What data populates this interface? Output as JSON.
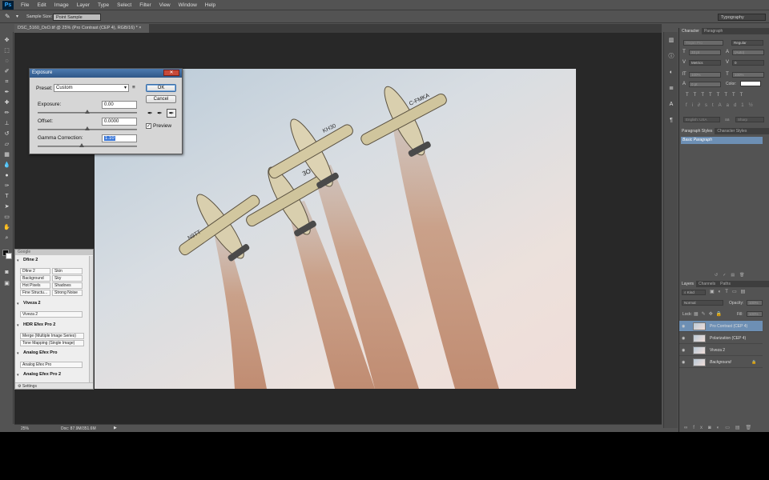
{
  "app": {
    "logo": "Ps"
  },
  "menubar": {
    "items": [
      "File",
      "Edit",
      "Image",
      "Layer",
      "Type",
      "Select",
      "Filter",
      "View",
      "Window",
      "Help"
    ]
  },
  "options": {
    "sample_size_label": "Sample Size:",
    "sample_size_value": "Point Sample",
    "workspace": "Typography"
  },
  "document": {
    "tab_title": "DSC_5160_DxO.tif @ 25% (Pro Contrast (CEP 4), RGB/16) *"
  },
  "status": {
    "zoom": "25%",
    "doc_info": "Doc: 87.9M/351.6M"
  },
  "exposure_dialog": {
    "title": "Exposure",
    "preset_label": "Preset:",
    "preset_value": "Custom",
    "exposure_label": "Exposure:",
    "exposure_value": "0.00",
    "offset_label": "Offset:",
    "offset_value": "0.0000",
    "gamma_label": "Gamma Correction:",
    "gamma_value": "1.10",
    "ok": "OK",
    "cancel": "Cancel",
    "preview": "Preview",
    "preview_checked": true
  },
  "google_panel": {
    "title": "Google",
    "dfine": {
      "title": "Dfine 2",
      "buttons": [
        "Dfine 2",
        "Skin",
        "Background",
        "Sky",
        "Hot Pixels",
        "Shadows",
        "Fine Structu...",
        "Strong Noise"
      ]
    },
    "viveza": {
      "title": "Viveza 2",
      "buttons": [
        "Viveza 2"
      ]
    },
    "hdr": {
      "title": "HDR Efex Pro 2",
      "buttons": [
        "Merge (Multiple Image Series)",
        "Tone Mapping (Single Image)"
      ]
    },
    "analog1": {
      "title": "Analog Efex Pro",
      "buttons": [
        "Analog Efex Pro"
      ]
    },
    "analog2": {
      "title": "Analog Efex Pro 2"
    },
    "settings": "Settings"
  },
  "character_panel": {
    "tabs": [
      "Character",
      "Paragraph"
    ],
    "font_family": "Trajan Pro",
    "font_style": "Regular",
    "size": "33 pt",
    "leading": "(Auto)",
    "kerning": "Metrics",
    "tracking": "0",
    "vscale": "100%",
    "hscale": "100%",
    "baseline": "0 pt",
    "color_label": "Color:",
    "language": "English: USA",
    "aa_label": "aa",
    "antialias": "Sharp"
  },
  "styles_panel": {
    "tabs": [
      "Paragraph Styles",
      "Character Styles"
    ],
    "item": "Basic Paragraph"
  },
  "layers_panel": {
    "tabs": [
      "Layers",
      "Channels",
      "Paths"
    ],
    "kind": "Kind",
    "blend_mode": "Normal",
    "opacity_label": "Opacity:",
    "opacity_value": "100%",
    "lock_label": "Lock:",
    "fill_label": "Fill:",
    "fill_value": "100%",
    "layers": [
      {
        "name": "Pro Contrast (CEP 4)",
        "selected": true
      },
      {
        "name": "Polarization (CEP 4)",
        "selected": false
      },
      {
        "name": "Viveza 2",
        "selected": false
      },
      {
        "name": "Background",
        "selected": false,
        "locked": true
      }
    ]
  },
  "planes": [
    {
      "code": "N9TT"
    },
    {
      "code": "3O7"
    },
    {
      "code": "KH30"
    },
    {
      "code": "C-FMKA"
    }
  ],
  "colors": {
    "accent": "#2f5788",
    "selection": "#6d8fb4"
  }
}
